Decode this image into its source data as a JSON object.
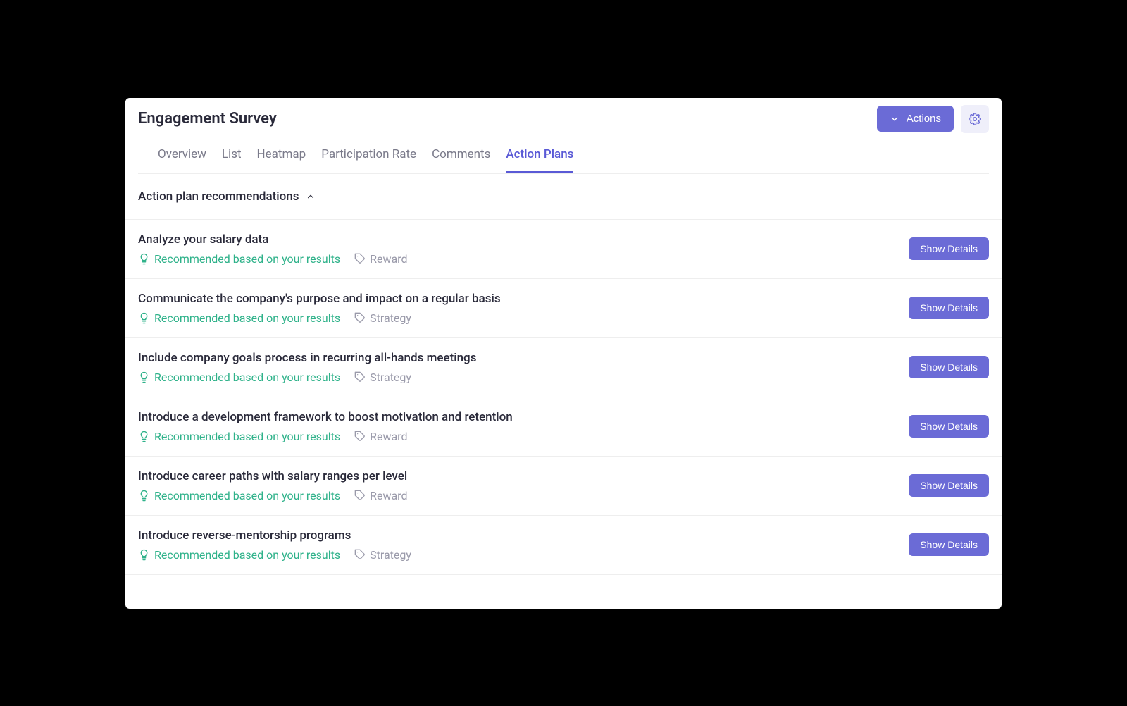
{
  "header": {
    "title": "Engagement Survey",
    "actions_label": "Actions"
  },
  "tabs": [
    {
      "label": "Overview",
      "active": false
    },
    {
      "label": "List",
      "active": false
    },
    {
      "label": "Heatmap",
      "active": false
    },
    {
      "label": "Participation Rate",
      "active": false
    },
    {
      "label": "Comments",
      "active": false
    },
    {
      "label": "Action Plans",
      "active": true
    }
  ],
  "section": {
    "title": "Action plan recommendations"
  },
  "recommendations": [
    {
      "title": "Analyze your salary data",
      "reason": "Recommended based on your results",
      "category": "Reward",
      "button": "Show Details"
    },
    {
      "title": "Communicate the company's purpose and impact on a regular basis",
      "reason": "Recommended based on your results",
      "category": "Strategy",
      "button": "Show Details"
    },
    {
      "title": "Include company goals process in recurring all-hands meetings",
      "reason": "Recommended based on your results",
      "category": "Strategy",
      "button": "Show Details"
    },
    {
      "title": "Introduce a development framework to boost motivation and retention",
      "reason": "Recommended based on your results",
      "category": "Reward",
      "button": "Show Details"
    },
    {
      "title": "Introduce career paths with salary ranges per level",
      "reason": "Recommended based on your results",
      "category": "Reward",
      "button": "Show Details"
    },
    {
      "title": "Introduce reverse-mentorship programs",
      "reason": "Recommended based on your results",
      "category": "Strategy",
      "button": "Show Details"
    }
  ]
}
